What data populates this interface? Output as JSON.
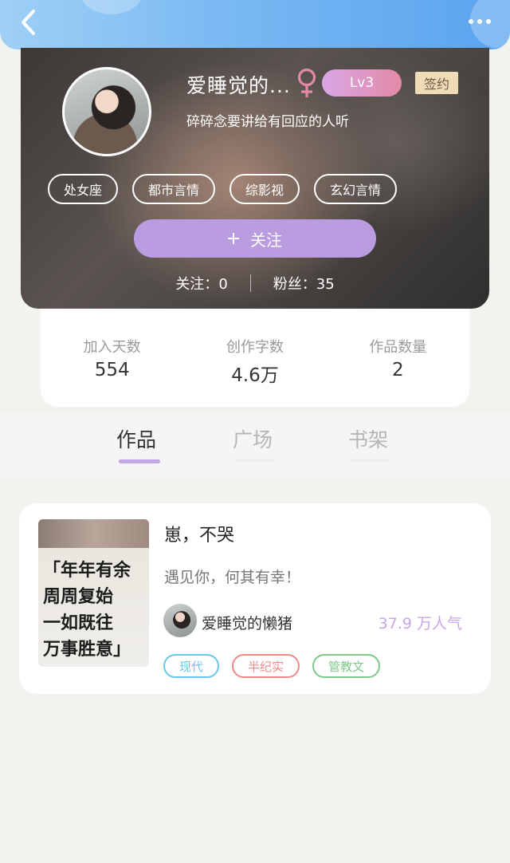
{
  "icons": {
    "back": "chevron-left-icon",
    "more": "more-dots-icon",
    "gender": "female-icon",
    "follow": "plus-icon"
  },
  "colors": {
    "accent": "#b99de0",
    "header_bar": "#6fb3f2",
    "popularity": "#c7a6ea",
    "tab_active": "#333333",
    "tab_inactive": "#b5b5b5",
    "tag_blue": "#64c8ee",
    "tag_red": "#ef8a8a",
    "tag_green": "#7cc98a"
  },
  "profile": {
    "name": "爱睡觉的...",
    "level": "Lv3",
    "signed": "签约",
    "bio": "碎碎念要讲给有回应的人听",
    "tags": [
      "处女座",
      "都市言情",
      "综影视",
      "玄幻言情"
    ],
    "follow_button": "关注",
    "following_label": "关注：",
    "following_count": "0",
    "fans_label": "粉丝：",
    "fans_count": "35"
  },
  "counts": [
    {
      "label": "加入天数",
      "value": "554"
    },
    {
      "label": "创作字数",
      "value": "4.6万"
    },
    {
      "label": "作品数量",
      "value": "2"
    }
  ],
  "tabs": [
    {
      "label": "作品",
      "active": true
    },
    {
      "label": "广场",
      "active": false
    },
    {
      "label": "书架",
      "active": false
    }
  ],
  "works": [
    {
      "title": "崽，不哭",
      "description": "遇见你，何其有幸！",
      "author": "爱睡觉的懒猪",
      "popularity": "37.9 万人气",
      "tags": [
        "现代",
        "半纪实",
        "管教文"
      ],
      "cover_text": [
        "「年年有余",
        "周周复始",
        "一如既往",
        "万事胜意」"
      ]
    }
  ]
}
